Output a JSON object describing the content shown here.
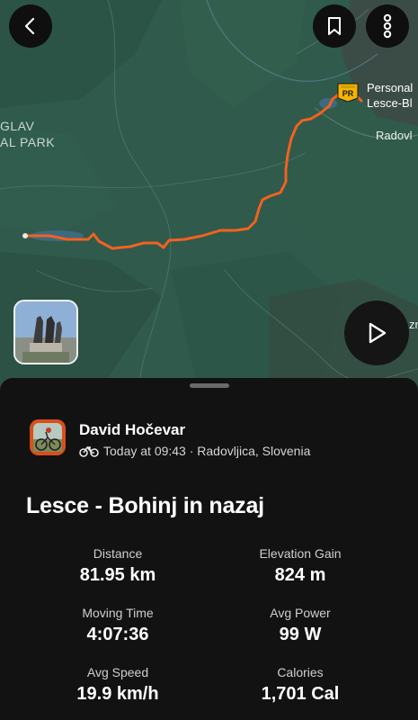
{
  "map": {
    "labels": {
      "park_line1": "GLAV",
      "park_line2": "AL PARK",
      "poi": "Personal",
      "poi_line2": "Lesce-Bl",
      "town": "Radovl",
      "edge": "zn"
    },
    "poi_badge": "PR",
    "route_color": "#f2621f",
    "map_color": "#2f5a4c"
  },
  "toolbar": {
    "back_icon": "chevron-left-icon",
    "bookmark_icon": "bookmark-icon",
    "more_icon": "more-vertical-icon",
    "play_icon": "play-icon"
  },
  "activity": {
    "athlete": "David Hočevar",
    "sport_icon": "bike-icon",
    "meta": "Today at 09:43 · Radovljica, Slovenia",
    "title": "Lesce - Bohinj in nazaj",
    "stats": [
      {
        "label": "Distance",
        "value": "81.95 km"
      },
      {
        "label": "Elevation Gain",
        "value": "824 m"
      },
      {
        "label": "Moving Time",
        "value": "4:07:36"
      },
      {
        "label": "Avg Power",
        "value": "99 W"
      },
      {
        "label": "Avg Speed",
        "value": "19.9 km/h"
      },
      {
        "label": "Calories",
        "value": "1,701 Cal"
      }
    ]
  }
}
